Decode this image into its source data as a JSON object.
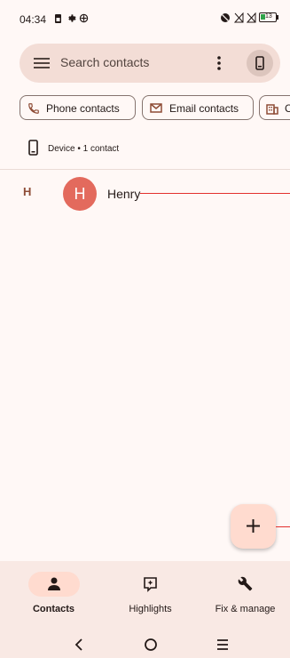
{
  "status_bar": {
    "time": "04:34",
    "battery": "13"
  },
  "search": {
    "placeholder": "Search contacts"
  },
  "chips": [
    {
      "label": "Phone contacts"
    },
    {
      "label": "Email contacts"
    },
    {
      "label": "C"
    }
  ],
  "account": {
    "label": "Device • 1 contact"
  },
  "contacts": [
    {
      "section": "H",
      "initial": "H",
      "name": "Henry"
    }
  ],
  "bottom_nav": {
    "items": [
      {
        "label": "Contacts",
        "selected": true
      },
      {
        "label": "Highlights",
        "selected": false
      },
      {
        "label": "Fix & manage",
        "selected": false
      }
    ]
  },
  "colors": {
    "accent": "#ffdbcf",
    "avatar": "#e36a5d",
    "surface": "#fff8f6"
  }
}
